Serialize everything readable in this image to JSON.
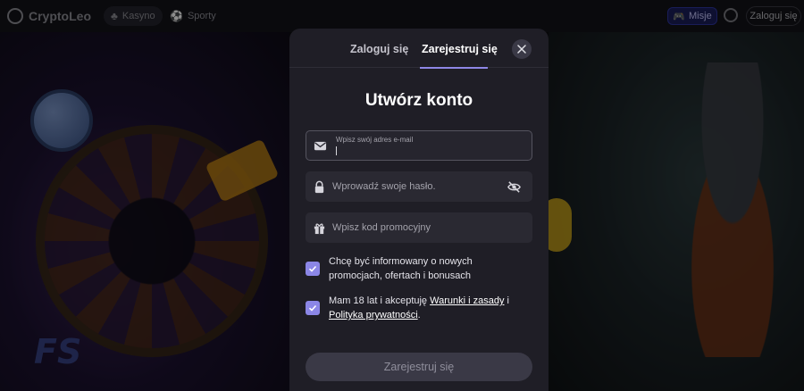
{
  "header": {
    "logo_text": "CryptoLeo",
    "nav": [
      {
        "label": "Kasyno",
        "icon": "casino-icon"
      },
      {
        "label": "Sporty",
        "icon": "soccer-ball-icon"
      }
    ],
    "missions_label": "Misje",
    "login_label": "Zaloguj się"
  },
  "background": {
    "promo_text": "FS"
  },
  "modal": {
    "tabs": {
      "login": "Zaloguj się",
      "register": "Zarejestruj się"
    },
    "active_tab": "register",
    "title": "Utwórz konto",
    "email": {
      "label": "Wpisz swój adres e-mail",
      "value": ""
    },
    "password": {
      "placeholder": "Wprowadź swoje hasło."
    },
    "promo": {
      "placeholder": "Wpisz kod promocyjny"
    },
    "checkbox_marketing": {
      "checked": true,
      "text_line1": "Chcę być informowany o nowych",
      "text_line2": "promocjach, ofertach i bonusach"
    },
    "checkbox_terms": {
      "checked": true,
      "prefix": "Mam 18 lat i akceptuję ",
      "terms_link": "Warunki i zasady",
      "and": " i",
      "privacy_link": "Polityka prywatności",
      "suffix": "."
    },
    "submit_label": "Zarejestruj się"
  },
  "colors": {
    "accent": "#8b86e6",
    "modal_bg": "#1f1e26",
    "field_bg": "#2a2932"
  }
}
